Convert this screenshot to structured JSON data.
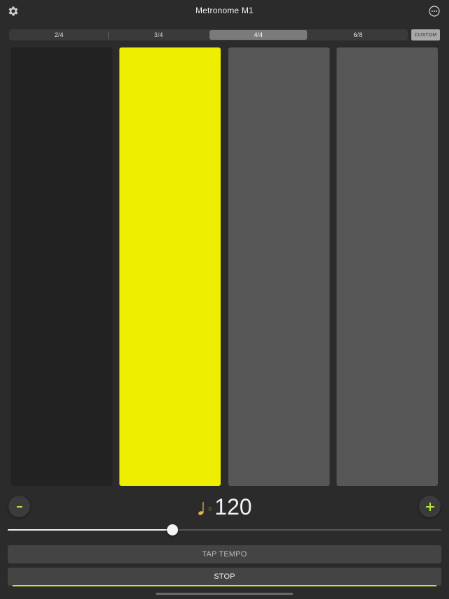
{
  "header": {
    "title": "Metronome M1",
    "left_icon": "gear-icon",
    "right_icon": "more-icon"
  },
  "time_signatures": {
    "options": [
      "2/4",
      "3/4",
      "4/4",
      "6/8"
    ],
    "selected": "4/4",
    "custom_label": "CUSTOM"
  },
  "beats": {
    "count": 4,
    "active_index": 1,
    "colors": {
      "past": "#222222",
      "active": "#eeee00",
      "upcoming": "#575757"
    }
  },
  "tempo": {
    "decrement_label": "−",
    "increment_label": "+",
    "note_icon": "quarter-note-icon",
    "equals": "=",
    "bpm": "120",
    "slider_fraction": 0.38
  },
  "buttons": {
    "tap_tempo": "TAP TEMPO",
    "stop": "STOP"
  },
  "colors": {
    "accent_green": "#b7e53a",
    "note_gold": "#e2b348",
    "background": "#2b2b2b"
  }
}
